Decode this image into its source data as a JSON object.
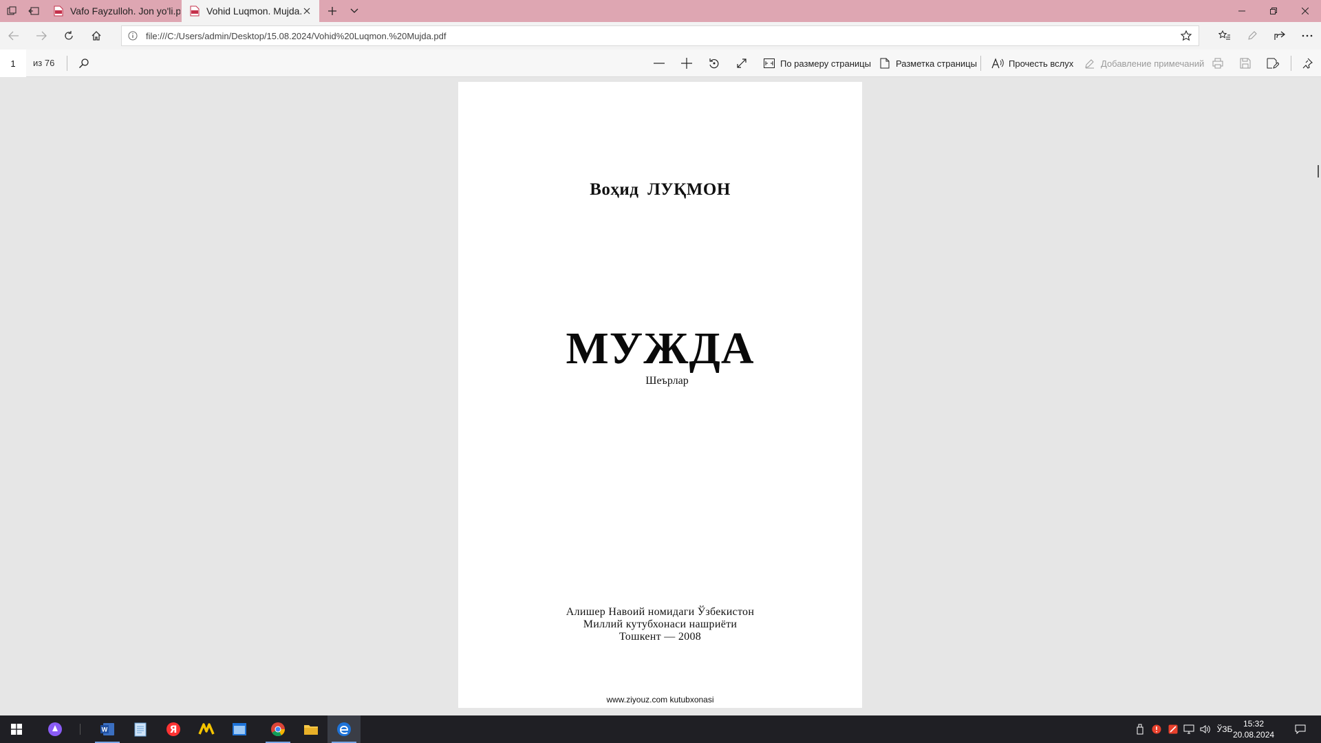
{
  "browser": {
    "tabs": [
      {
        "label": "Vafo Fayzulloh. Jon yo'li.pdf",
        "active": false
      },
      {
        "label": "Vohid Luqmon. Mujda.p",
        "active": true
      }
    ],
    "address": "file:///C:/Users/admin/Desktop/15.08.2024/Vohid%20Luqmon.%20Mujda.pdf"
  },
  "pdf_toolbar": {
    "page_current": "1",
    "page_total": "из 76",
    "fit_page": "По размеру страницы",
    "page_layout": "Разметка страницы",
    "read_aloud": "Прочесть вслух",
    "add_notes": "Добавление примечаний"
  },
  "document": {
    "author": "Воҳид ЛУҚМОН",
    "title": "МУЖДА",
    "subtitle": "Шеърлар",
    "publisher_lines": [
      "Алишер Навоий номидаги Ўзбекистон",
      "Миллий  кутубхонаси нашриёти",
      "Тошкент — 2008"
    ],
    "footer": "www.ziyouz.com kutubxonasi"
  },
  "taskbar": {
    "language": "ЎЗБ",
    "time": "15:32",
    "date": "20.08.2024"
  },
  "colors": {
    "tabbar": "#dea6b2",
    "taskbar": "#1f1f24",
    "viewer_bg": "#e6e6e6",
    "edge_blue": "#1e73d8"
  }
}
